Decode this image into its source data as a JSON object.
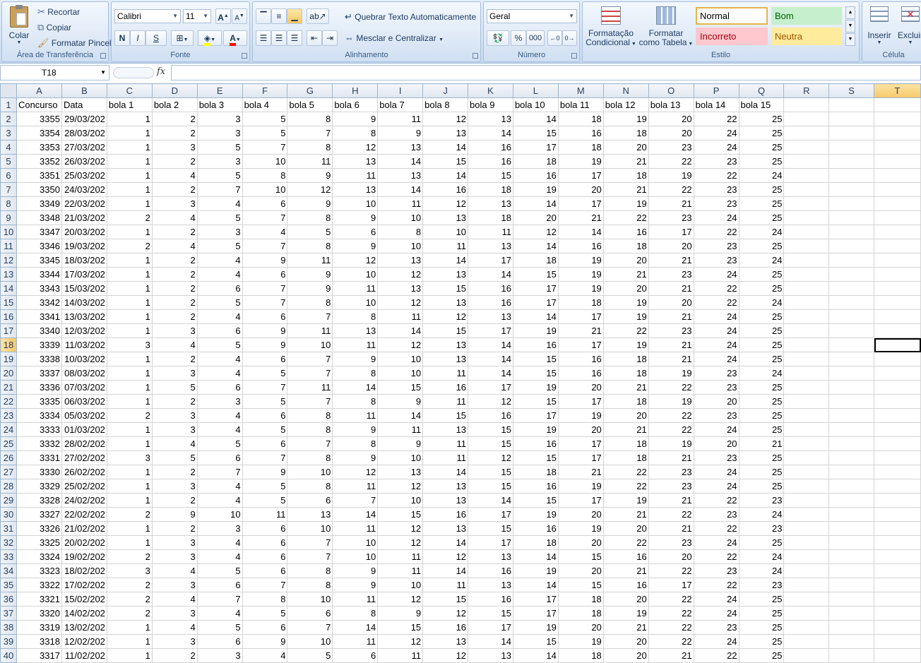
{
  "ribbon": {
    "clipboard": {
      "paste": "Colar",
      "cut": "Recortar",
      "copy": "Copiar",
      "format_painter": "Formatar Pincel",
      "label": "Área de Transferência"
    },
    "font": {
      "name": "Calibri",
      "size": "11",
      "bold": "N",
      "italic": "I",
      "underline": "S",
      "label": "Fonte"
    },
    "alignment": {
      "wrap": "Quebrar Texto Automaticamente",
      "merge": "Mesclar e Centralizar",
      "label": "Alinhamento"
    },
    "number": {
      "format": "Geral",
      "percent": "%",
      "thousands": "000",
      "label": "Número"
    },
    "styles": {
      "conditional": "Formatação\nCondicional",
      "conditional_l1": "Formatação",
      "conditional_l2": "Condicional",
      "table_l1": "Formatar",
      "table_l2": "como Tabela",
      "normal": "Normal",
      "bom": "Bom",
      "incorreto": "Incorreto",
      "neutra": "Neutra",
      "label": "Estilo"
    },
    "cells": {
      "insert": "Inserir",
      "delete": "Excluir",
      "label": "Célula"
    }
  },
  "formula_bar": {
    "name_box": "T18",
    "fx": "fx",
    "formula": ""
  },
  "colors": {
    "bom_bg": "#c6efce",
    "bom_fg": "#006100",
    "incorreto_bg": "#ffc7ce",
    "incorreto_fg": "#9c0006",
    "neutra_bg": "#ffeb9c",
    "neutra_fg": "#9c5700",
    "selected_header": "#f7c86a"
  },
  "grid": {
    "columns": [
      "A",
      "B",
      "C",
      "D",
      "E",
      "F",
      "G",
      "H",
      "I",
      "J",
      "K",
      "L",
      "M",
      "N",
      "O",
      "P",
      "Q",
      "R",
      "S",
      "T"
    ],
    "selected_row": "18",
    "selected_col": "T",
    "header_row": [
      "Concurso",
      "Data",
      "bola 1",
      "bola 2",
      "bola 3",
      "bola 4",
      "bola 5",
      "bola 6",
      "bola 7",
      "bola 8",
      "bola 9",
      "bola 10",
      "bola 11",
      "bola 12",
      "bola 13",
      "bola 14",
      "bola 15"
    ],
    "rows": [
      [
        "3355",
        "29/03/202",
        "1",
        "2",
        "3",
        "5",
        "8",
        "9",
        "11",
        "12",
        "13",
        "14",
        "18",
        "19",
        "20",
        "22",
        "25"
      ],
      [
        "3354",
        "28/03/202",
        "1",
        "2",
        "3",
        "5",
        "7",
        "8",
        "9",
        "13",
        "14",
        "15",
        "16",
        "18",
        "20",
        "24",
        "25"
      ],
      [
        "3353",
        "27/03/202",
        "1",
        "3",
        "5",
        "7",
        "8",
        "12",
        "13",
        "14",
        "16",
        "17",
        "18",
        "20",
        "23",
        "24",
        "25"
      ],
      [
        "3352",
        "26/03/202",
        "1",
        "2",
        "3",
        "10",
        "11",
        "13",
        "14",
        "15",
        "16",
        "18",
        "19",
        "21",
        "22",
        "23",
        "25"
      ],
      [
        "3351",
        "25/03/202",
        "1",
        "4",
        "5",
        "8",
        "9",
        "11",
        "13",
        "14",
        "15",
        "16",
        "17",
        "18",
        "19",
        "22",
        "24"
      ],
      [
        "3350",
        "24/03/202",
        "1",
        "2",
        "7",
        "10",
        "12",
        "13",
        "14",
        "16",
        "18",
        "19",
        "20",
        "21",
        "22",
        "23",
        "25"
      ],
      [
        "3349",
        "22/03/202",
        "1",
        "3",
        "4",
        "6",
        "9",
        "10",
        "11",
        "12",
        "13",
        "14",
        "17",
        "19",
        "21",
        "23",
        "25"
      ],
      [
        "3348",
        "21/03/202",
        "2",
        "4",
        "5",
        "7",
        "8",
        "9",
        "10",
        "13",
        "18",
        "20",
        "21",
        "22",
        "23",
        "24",
        "25"
      ],
      [
        "3347",
        "20/03/202",
        "1",
        "2",
        "3",
        "4",
        "5",
        "6",
        "8",
        "10",
        "11",
        "12",
        "14",
        "16",
        "17",
        "22",
        "24"
      ],
      [
        "3346",
        "19/03/202",
        "2",
        "4",
        "5",
        "7",
        "8",
        "9",
        "10",
        "11",
        "13",
        "14",
        "16",
        "18",
        "20",
        "23",
        "25"
      ],
      [
        "3345",
        "18/03/202",
        "1",
        "2",
        "4",
        "9",
        "11",
        "12",
        "13",
        "14",
        "17",
        "18",
        "19",
        "20",
        "21",
        "23",
        "24"
      ],
      [
        "3344",
        "17/03/202",
        "1",
        "2",
        "4",
        "6",
        "9",
        "10",
        "12",
        "13",
        "14",
        "15",
        "19",
        "21",
        "23",
        "24",
        "25"
      ],
      [
        "3343",
        "15/03/202",
        "1",
        "2",
        "6",
        "7",
        "9",
        "11",
        "13",
        "15",
        "16",
        "17",
        "19",
        "20",
        "21",
        "22",
        "25"
      ],
      [
        "3342",
        "14/03/202",
        "1",
        "2",
        "5",
        "7",
        "8",
        "10",
        "12",
        "13",
        "16",
        "17",
        "18",
        "19",
        "20",
        "22",
        "24"
      ],
      [
        "3341",
        "13/03/202",
        "1",
        "2",
        "4",
        "6",
        "7",
        "8",
        "11",
        "12",
        "13",
        "14",
        "17",
        "19",
        "21",
        "24",
        "25"
      ],
      [
        "3340",
        "12/03/202",
        "1",
        "3",
        "6",
        "9",
        "11",
        "13",
        "14",
        "15",
        "17",
        "19",
        "21",
        "22",
        "23",
        "24",
        "25"
      ],
      [
        "3339",
        "11/03/202",
        "3",
        "4",
        "5",
        "9",
        "10",
        "11",
        "12",
        "13",
        "14",
        "16",
        "17",
        "19",
        "21",
        "24",
        "25"
      ],
      [
        "3338",
        "10/03/202",
        "1",
        "2",
        "4",
        "6",
        "7",
        "9",
        "10",
        "13",
        "14",
        "15",
        "16",
        "18",
        "21",
        "24",
        "25"
      ],
      [
        "3337",
        "08/03/202",
        "1",
        "3",
        "4",
        "5",
        "7",
        "8",
        "10",
        "11",
        "14",
        "15",
        "16",
        "18",
        "19",
        "23",
        "24"
      ],
      [
        "3336",
        "07/03/202",
        "1",
        "5",
        "6",
        "7",
        "11",
        "14",
        "15",
        "16",
        "17",
        "19",
        "20",
        "21",
        "22",
        "23",
        "25"
      ],
      [
        "3335",
        "06/03/202",
        "1",
        "2",
        "3",
        "5",
        "7",
        "8",
        "9",
        "11",
        "12",
        "15",
        "17",
        "18",
        "19",
        "20",
        "25"
      ],
      [
        "3334",
        "05/03/202",
        "2",
        "3",
        "4",
        "6",
        "8",
        "11",
        "14",
        "15",
        "16",
        "17",
        "19",
        "20",
        "22",
        "23",
        "25"
      ],
      [
        "3333",
        "01/03/202",
        "1",
        "3",
        "4",
        "5",
        "8",
        "9",
        "11",
        "13",
        "15",
        "19",
        "20",
        "21",
        "22",
        "24",
        "25"
      ],
      [
        "3332",
        "28/02/202",
        "1",
        "4",
        "5",
        "6",
        "7",
        "8",
        "9",
        "11",
        "15",
        "16",
        "17",
        "18",
        "19",
        "20",
        "21"
      ],
      [
        "3331",
        "27/02/202",
        "3",
        "5",
        "6",
        "7",
        "8",
        "9",
        "10",
        "11",
        "12",
        "15",
        "17",
        "18",
        "21",
        "23",
        "25"
      ],
      [
        "3330",
        "26/02/202",
        "1",
        "2",
        "7",
        "9",
        "10",
        "12",
        "13",
        "14",
        "15",
        "18",
        "21",
        "22",
        "23",
        "24",
        "25"
      ],
      [
        "3329",
        "25/02/202",
        "1",
        "3",
        "4",
        "5",
        "8",
        "11",
        "12",
        "13",
        "15",
        "16",
        "19",
        "22",
        "23",
        "24",
        "25"
      ],
      [
        "3328",
        "24/02/202",
        "1",
        "2",
        "4",
        "5",
        "6",
        "7",
        "10",
        "13",
        "14",
        "15",
        "17",
        "19",
        "21",
        "22",
        "23"
      ],
      [
        "3327",
        "22/02/202",
        "2",
        "9",
        "10",
        "11",
        "13",
        "14",
        "15",
        "16",
        "17",
        "19",
        "20",
        "21",
        "22",
        "23",
        "24"
      ],
      [
        "3326",
        "21/02/202",
        "1",
        "2",
        "3",
        "6",
        "10",
        "11",
        "12",
        "13",
        "15",
        "16",
        "19",
        "20",
        "21",
        "22",
        "23"
      ],
      [
        "3325",
        "20/02/202",
        "1",
        "3",
        "4",
        "6",
        "7",
        "10",
        "12",
        "14",
        "17",
        "18",
        "20",
        "22",
        "23",
        "24",
        "25"
      ],
      [
        "3324",
        "19/02/202",
        "2",
        "3",
        "4",
        "6",
        "7",
        "10",
        "11",
        "12",
        "13",
        "14",
        "15",
        "16",
        "20",
        "22",
        "24"
      ],
      [
        "3323",
        "18/02/202",
        "3",
        "4",
        "5",
        "6",
        "8",
        "9",
        "11",
        "14",
        "16",
        "19",
        "20",
        "21",
        "22",
        "23",
        "24"
      ],
      [
        "3322",
        "17/02/202",
        "2",
        "3",
        "6",
        "7",
        "8",
        "9",
        "10",
        "11",
        "13",
        "14",
        "15",
        "16",
        "17",
        "22",
        "23"
      ],
      [
        "3321",
        "15/02/202",
        "2",
        "4",
        "7",
        "8",
        "10",
        "11",
        "12",
        "15",
        "16",
        "17",
        "18",
        "20",
        "22",
        "24",
        "25"
      ],
      [
        "3320",
        "14/02/202",
        "2",
        "3",
        "4",
        "5",
        "6",
        "8",
        "9",
        "12",
        "15",
        "17",
        "18",
        "19",
        "22",
        "24",
        "25"
      ],
      [
        "3319",
        "13/02/202",
        "1",
        "4",
        "5",
        "6",
        "7",
        "14",
        "15",
        "16",
        "17",
        "19",
        "20",
        "21",
        "22",
        "23",
        "25"
      ],
      [
        "3318",
        "12/02/202",
        "1",
        "3",
        "6",
        "9",
        "10",
        "11",
        "12",
        "13",
        "14",
        "15",
        "19",
        "20",
        "22",
        "24",
        "25"
      ],
      [
        "3317",
        "11/02/202",
        "1",
        "2",
        "3",
        "4",
        "5",
        "6",
        "11",
        "12",
        "13",
        "14",
        "18",
        "20",
        "21",
        "22",
        "25"
      ]
    ]
  }
}
